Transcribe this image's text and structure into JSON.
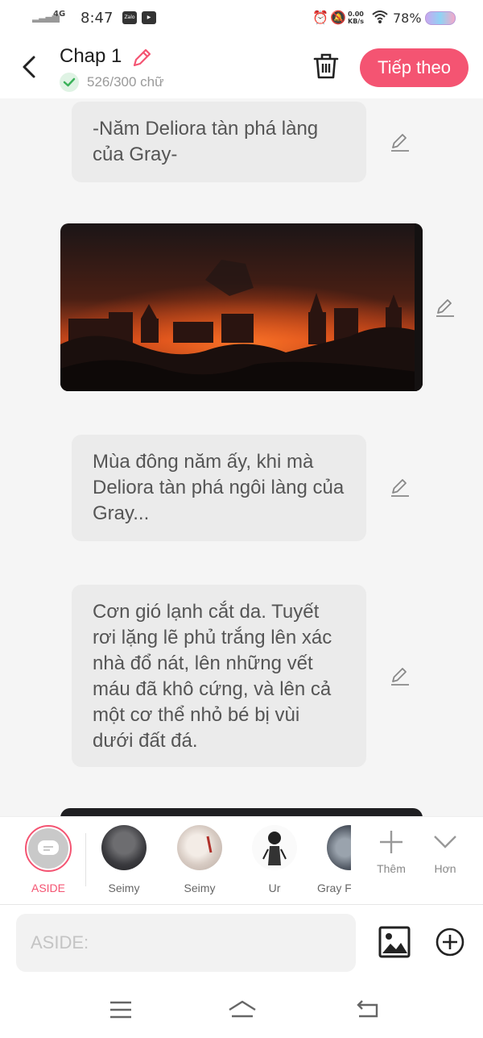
{
  "status_bar": {
    "network": "4G",
    "time": "8:47",
    "app_icons": [
      "Zalo",
      "video"
    ],
    "speed_value": "0.00",
    "speed_unit": "KB/s",
    "battery": "78%"
  },
  "header": {
    "title": "Chap 1",
    "word_count": "526/300 chữ",
    "next_label": "Tiếp theo"
  },
  "messages": [
    {
      "type": "text",
      "text": "-Năm Deliora tàn phá làng của Gray-"
    },
    {
      "type": "image",
      "description": "burning village"
    },
    {
      "type": "text",
      "text": "Mùa đông năm ấy, khi mà Deliora tàn phá ngôi làng của Gray..."
    },
    {
      "type": "text",
      "text": "Cơn gió lạnh cắt da. Tuyết rơi lặng lẽ phủ trắng lên xác nhà đổ nát, lên những vết máu đã khô cứng, và lên cả một cơ thể nhỏ bé bị vùi dưới đất đá."
    }
  ],
  "characters": [
    {
      "name": "ASIDE",
      "selected": true,
      "color": "#f45472"
    },
    {
      "name": "Seimy"
    },
    {
      "name": "Seimy"
    },
    {
      "name": "Ur"
    },
    {
      "name": "Gray F"
    }
  ],
  "tools": {
    "add_label": "Thêm",
    "more_label": "Hơn"
  },
  "composer": {
    "placeholder": "ASIDE:"
  },
  "colors": {
    "accent": "#f45472",
    "bubble": "#ebebeb",
    "background": "#f5f5f5"
  }
}
